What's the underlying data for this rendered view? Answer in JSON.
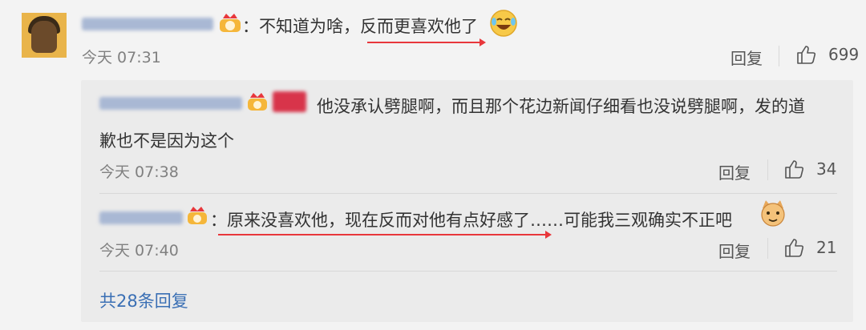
{
  "comment": {
    "username": "",
    "text": "：不知道为啥，反而更喜欢他了",
    "time": "今天 07:31",
    "reply_label": "回复",
    "like_count": "699"
  },
  "replies": [
    {
      "username": "",
      "text_line1": "他没承认劈腿啊，而且那个花边新闻仔细看也没说劈腿啊，发的道",
      "text_line2": "歉也不是因为这个",
      "time": "今天 07:38",
      "reply_label": "回复",
      "like_count": "34"
    },
    {
      "username": "",
      "text": "：原来没喜欢他，现在反而对他有点好感了……可能我三观确实不正吧",
      "time": "今天 07:40",
      "reply_label": "回复",
      "like_count": "21"
    }
  ],
  "more_replies": "共28条回复",
  "colors": {
    "link": "#3a6fb4",
    "underline": "#e8373b",
    "background": "#f3f3f3",
    "reply_box": "#ebebeb"
  }
}
